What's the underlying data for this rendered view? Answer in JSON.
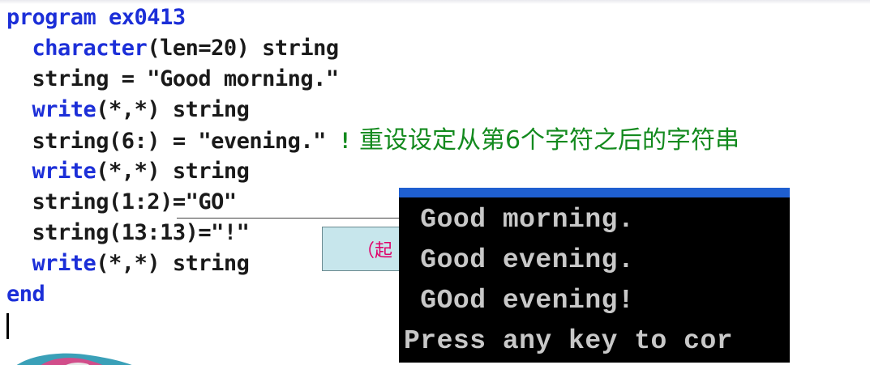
{
  "code": {
    "lines": [
      {
        "segments": [
          {
            "text": "program ex0413",
            "style": "kw"
          }
        ]
      },
      {
        "segments": [
          {
            "text": "  "
          },
          {
            "text": "character",
            "style": "kw"
          },
          {
            "text": "(len=20) string"
          }
        ]
      },
      {
        "segments": [
          {
            "text": "  string = \"Good morning.\""
          }
        ]
      },
      {
        "segments": [
          {
            "text": "  "
          },
          {
            "text": "write",
            "style": "kw"
          },
          {
            "text": "(*,*) string"
          }
        ]
      },
      {
        "segments": [
          {
            "text": "  string(6:) = \"evening.\" "
          },
          {
            "text": "!",
            "style": "cm-mark"
          },
          {
            "text": " 重设设定从第6个字符之后的字符串",
            "style": "cm"
          }
        ]
      },
      {
        "segments": [
          {
            "text": "  "
          },
          {
            "text": "write",
            "style": "kw"
          },
          {
            "text": "(*,*) string"
          }
        ]
      },
      {
        "segments": [
          {
            "text": "  string(1:2)=\"GO\""
          }
        ]
      },
      {
        "segments": [
          {
            "text": "  string(13:13)=\"!\""
          }
        ]
      },
      {
        "segments": [
          {
            "text": "  "
          },
          {
            "text": "write",
            "style": "kw"
          },
          {
            "text": "(*,*) string"
          }
        ]
      },
      {
        "segments": [
          {
            "text": "end",
            "style": "kw"
          }
        ]
      }
    ]
  },
  "callout": {
    "text": "（起"
  },
  "console": {
    "lines": [
      " Good morning.",
      " Good evening.",
      " GOod evening!",
      "Press any key to cor"
    ]
  },
  "colors": {
    "keyword": "#1c2fd8",
    "comment": "#138a1e",
    "code_text": "#1a1a1a",
    "console_bg": "#000000",
    "console_text": "#c8c8c8",
    "console_titlebar": "#1f5fd0",
    "callout_bg": "#c7e6ec",
    "callout_text": "#e0006a"
  }
}
